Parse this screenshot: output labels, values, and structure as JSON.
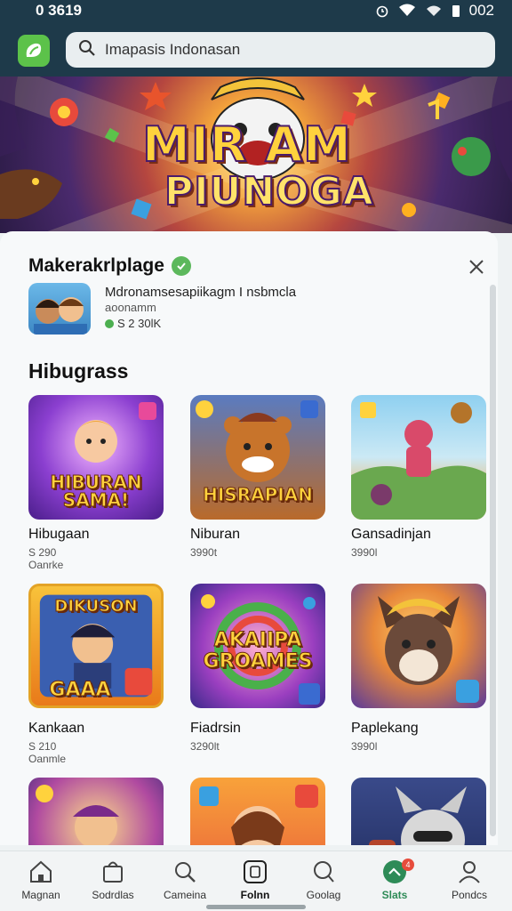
{
  "status_bar": {
    "time": "0 3619",
    "battery": "002"
  },
  "search": {
    "placeholder": "Imapasis Indonasan"
  },
  "hero": {
    "title_line1": "MIR AM",
    "title_line2": "PIUNOGA"
  },
  "sheet": {
    "title": "Makerakrlplage",
    "developer_name": "Mdronamsesapiikagm I nsbmcla",
    "developer_sub": "aoonamm",
    "developer_price": "S 2 30lK",
    "section_title": "Hibugrass"
  },
  "games": [
    {
      "name": "Hibugaan",
      "price": "S 290",
      "meta": "Oanrke",
      "art_text": "HIBURAN SAMA!"
    },
    {
      "name": "Niburan",
      "price": "3990t",
      "meta": "",
      "art_text": "HISRAPIAN"
    },
    {
      "name": "Gansadinjan",
      "price": "3990l",
      "meta": "",
      "art_text": ""
    },
    {
      "name": "Kankaan",
      "price": "S 210",
      "meta": "Oanmle",
      "art_text_top": "DIKUSON",
      "art_text": "GAAA"
    },
    {
      "name": "Fiadrsin",
      "price": "3290lt",
      "meta": "",
      "art_text": "AKAIIPA GROAMES"
    },
    {
      "name": "Paplekang",
      "price": "3990l",
      "meta": "",
      "art_text": ""
    },
    {
      "name": "",
      "price": "",
      "meta": "",
      "art_text": ""
    },
    {
      "name": "",
      "price": "",
      "meta": "",
      "art_text": ""
    },
    {
      "name": "",
      "price": "",
      "meta": "",
      "art_text": ""
    }
  ],
  "nav": [
    {
      "label": "Magnan",
      "icon": "home-icon"
    },
    {
      "label": "Sodrdlas",
      "icon": "bag-icon"
    },
    {
      "label": "Cameina",
      "icon": "search-icon"
    },
    {
      "label": "Folnn",
      "icon": "app-icon"
    },
    {
      "label": "Goolag",
      "icon": "chat-icon"
    },
    {
      "label": "Slats",
      "icon": "stats-icon",
      "badge": "4"
    },
    {
      "label": "Pondcs",
      "icon": "person-icon"
    }
  ],
  "colors": {
    "appbar": "#1e3a4a",
    "accent": "#5cc24a",
    "active": "#2e8b57"
  }
}
